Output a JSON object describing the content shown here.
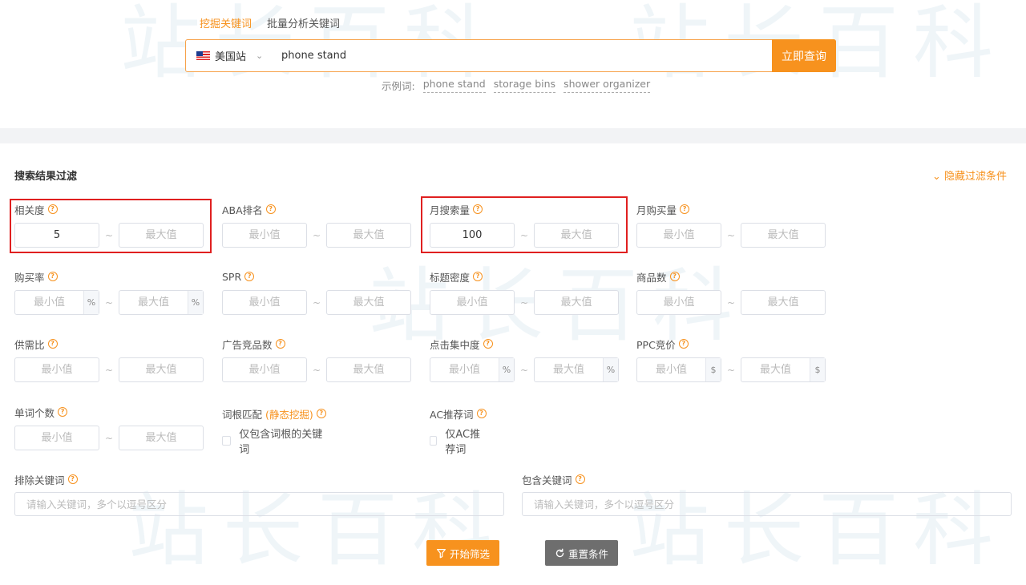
{
  "watermark": {
    "text": "站长百科"
  },
  "search": {
    "tabs": [
      {
        "label": "挖掘关键词",
        "active": true
      },
      {
        "label": "批量分析关键词",
        "active": false
      }
    ],
    "site": {
      "label": "美国站",
      "flag_icon": "us-flag-icon"
    },
    "query": "phone stand",
    "submit_label": "立即查询",
    "examples_label": "示例词:",
    "examples": [
      "phone stand",
      "storage bins",
      "shower organizer"
    ]
  },
  "filters": {
    "title": "搜索结果过滤",
    "hide_label": "隐藏过滤条件",
    "min_placeholder": "最小值",
    "max_placeholder": "最大值",
    "separator": "~",
    "items": {
      "relevance": {
        "label": "相关度",
        "min": "5",
        "max": ""
      },
      "aba_rank": {
        "label": "ABA排名",
        "min": "",
        "max": ""
      },
      "monthly_search": {
        "label": "月搜索量",
        "min": "100",
        "max": ""
      },
      "monthly_purchase": {
        "label": "月购买量",
        "min": "",
        "max": ""
      },
      "purchase_rate": {
        "label": "购买率",
        "unit": "%"
      },
      "spr": {
        "label": "SPR"
      },
      "title_density": {
        "label": "标题密度"
      },
      "product_count": {
        "label": "商品数"
      },
      "supply_demand": {
        "label": "供需比"
      },
      "ad_product_count": {
        "label": "广告竞品数"
      },
      "click_concentration": {
        "label": "点击集中度",
        "unit": "%"
      },
      "ppc_bid": {
        "label": "PPC竞价",
        "unit": "$"
      },
      "word_count": {
        "label": "单词个数"
      },
      "root_match": {
        "label": "词根匹配",
        "sub_label": "(静态挖掘)",
        "checkbox_label": "仅包含词根的关键词",
        "checked": false
      },
      "ac_recommend": {
        "label": "AC推荐词",
        "checkbox_label": "仅AC推荐词",
        "checked": false
      },
      "exclude_keywords": {
        "label": "排除关键词",
        "placeholder": "请输入关键词，多个以逗号区分"
      },
      "include_keywords": {
        "label": "包含关键词",
        "placeholder": "请输入关键词，多个以逗号区分"
      }
    },
    "start_label": "开始筛选",
    "reset_label": "重置条件"
  },
  "colors": {
    "accent": "#f7921e",
    "highlight": "#e02020",
    "reset_button": "#6e6e6e"
  }
}
